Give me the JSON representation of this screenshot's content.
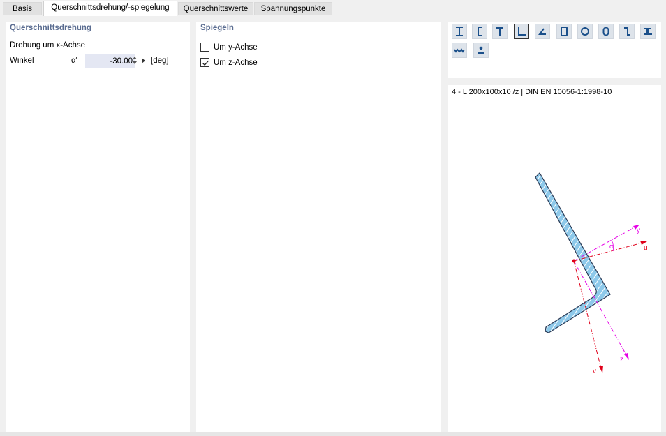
{
  "tabs": [
    {
      "label": "Basis",
      "active": false
    },
    {
      "label": "Querschnittsdrehung/-spiegelung",
      "active": true
    },
    {
      "label": "Querschnittswerte",
      "active": false
    },
    {
      "label": "Spannungspunkte",
      "active": false
    }
  ],
  "rotation": {
    "title": "Querschnittsdrehung",
    "subtitle": "Drehung um x-Achse",
    "angle_label": "Winkel",
    "angle_symbol": "α'",
    "angle_value": "-30.00",
    "angle_unit": "[deg]"
  },
  "mirror": {
    "title": "Spiegeln",
    "options": [
      {
        "label": "Um y-Achse",
        "checked": false
      },
      {
        "label": "Um z-Achse",
        "checked": true
      }
    ]
  },
  "shape_selector": {
    "icons": [
      "i-beam-icon",
      "channel-icon",
      "t-beam-icon",
      "angle-icon",
      "unequal-angle-icon",
      "rectangular-tube-icon",
      "circular-tube-icon",
      "rounded-tube-icon",
      "z-section-icon",
      "rail-icon",
      "sheet-pile-icon",
      "weld-section-icon"
    ],
    "active_index": 3
  },
  "preview": {
    "profile_text": "4 - L 200x100x10 /z | DIN EN 10056-1:1998-10",
    "axis_labels": {
      "y": "y",
      "z": "z",
      "u": "u",
      "v": "v",
      "alpha": "α"
    },
    "colors": {
      "section_fill": "#8ec9ea",
      "section_stroke": "#2a3a55",
      "principal_axis": "#e0001a",
      "centroid_axis": "#e600e6"
    }
  }
}
